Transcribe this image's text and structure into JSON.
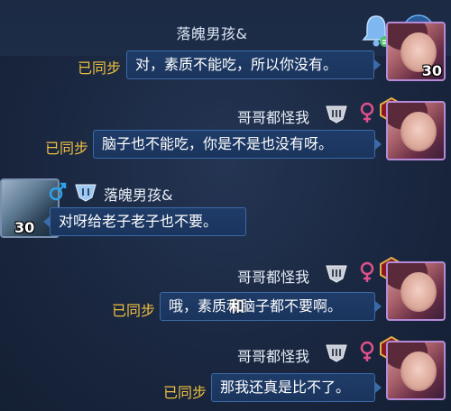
{
  "header": {
    "title": "落魄男孩&"
  },
  "messages": [
    {
      "sync": "已同步",
      "text": "对，素质不能吃，所以你没有。",
      "level": "30"
    },
    {
      "user": "哥哥都怪我",
      "badge": "8",
      "sync": "已同步",
      "text": "脑子也不能吃，你是不是也没有呀。"
    },
    {
      "user": "落魄男孩&",
      "text": "对呀给老子老子也不要。",
      "level": "30"
    },
    {
      "user": "哥哥都怪我",
      "badge": "8",
      "sync": "已同步",
      "text": "哦，素质和脑子都不要啊。",
      "overlay": "和"
    },
    {
      "user": "哥哥都怪我",
      "badge": "8",
      "sync": "已同步",
      "text": "那我还真是比不了。"
    }
  ],
  "colors": {
    "sync": "#f0c040",
    "bubble_border": "#3b6aa8",
    "female": "#e0508a",
    "male": "#2ea3e8"
  }
}
